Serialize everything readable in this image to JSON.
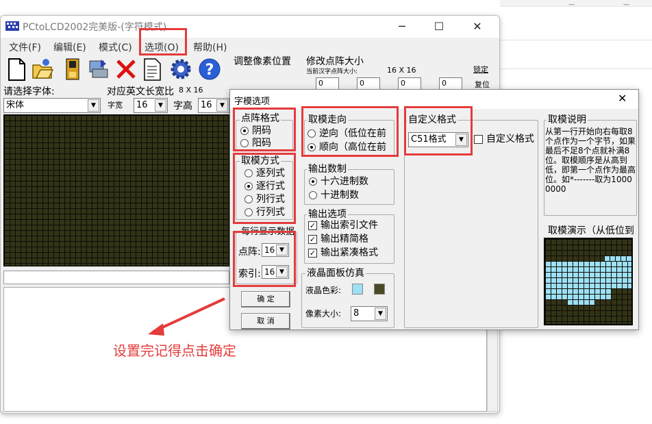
{
  "main_window": {
    "title": "PCtoLCD2002完美版-(字符模式)",
    "controls": {
      "minimize": "─",
      "maximize": "☐",
      "close": "✕"
    },
    "menu": [
      "文件(F)",
      "编辑(E)",
      "模式(C)",
      "选项(O)",
      "帮助(H)"
    ],
    "toolbar_icons": [
      "new-file-icon",
      "open-folder-icon",
      "save-icon",
      "export-icon",
      "delete-icon",
      "document-icon",
      "settings-icon",
      "help-icon"
    ],
    "font_label": "请选择字体:",
    "font_value": "宋体",
    "width_label": "对应英文长宽比",
    "width_value": "8 X 16",
    "char_width_label": "字宽",
    "char_width_value": "16",
    "char_height_label": "字高",
    "char_height_value": "16",
    "adjust_pixel_label": "调整像素位置",
    "modify_size_label": "修改点阵大小",
    "current_size_label": "当前汉字点阵大小:",
    "current_size_value": "16 X 16",
    "lock_label": "锁定",
    "reset_label": "复位",
    "size_inputs": [
      "0",
      "0",
      "0",
      "0"
    ]
  },
  "background_window": {
    "glyph1": "—",
    "glyph2": "—"
  },
  "dialog": {
    "title": "字模选项",
    "close": "✕",
    "dot_format": {
      "title": "点阵格式",
      "options": [
        "阴码",
        "阳码"
      ],
      "selected": 0
    },
    "scan_mode": {
      "title": "取模方式",
      "options": [
        "逐列式",
        "逐行式",
        "列行式",
        "行列式"
      ],
      "selected": 1
    },
    "per_line": {
      "title": "每行显示数据",
      "dot_label": "点阵:",
      "dot_value": "16",
      "index_label": "索引:",
      "index_value": "16"
    },
    "buttons": {
      "ok": "确  定",
      "cancel": "取  消"
    },
    "direction": {
      "title": "取模走向",
      "options": [
        "逆向（低位在前",
        "顺向（高位在前"
      ],
      "selected": 1
    },
    "output_base": {
      "title": "输出数制",
      "options": [
        "十六进制数",
        "十进制数"
      ],
      "selected": 0
    },
    "output_opts": {
      "title": "输出选项",
      "options": [
        "输出索引文件",
        "输出精简格",
        "输出紧凑格式"
      ]
    },
    "lcd_sim": {
      "title": "液晶面板仿真",
      "color_label": "液晶色彩:",
      "lcd_color": "#9ee0f5",
      "dark_color": "#4a4a26",
      "pixel_label": "像素大小:",
      "pixel_value": "8"
    },
    "custom_format": {
      "title": "自定义格式",
      "value": "C51格式",
      "checkbox_label": "自定义格式"
    },
    "description": {
      "title": "取模说明",
      "text": "从第一行开始向右每取8个点作为一个字节，如果最后不足8个点就补满8位。取模顺序是从高到低，即第一个点作为最高位。如*-------取为10000000"
    },
    "demo": {
      "title": "取模演示（从低位到"
    }
  },
  "annotation": {
    "text": "设置完记得点击确定"
  }
}
